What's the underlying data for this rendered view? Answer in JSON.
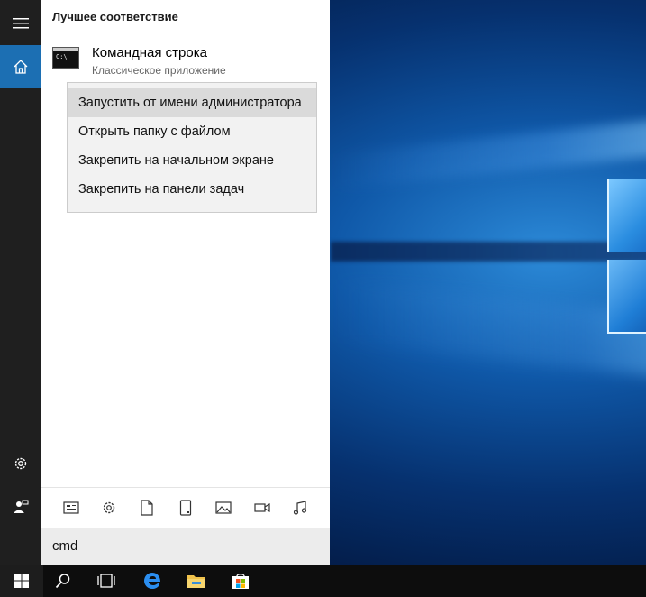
{
  "panel": {
    "section_title": "Лучшее соответствие",
    "best_match": {
      "title": "Командная строка",
      "subtitle": "Классическое приложение",
      "icon": "cmd-icon",
      "icon_text": "C:\\_"
    },
    "context_menu": {
      "items": [
        {
          "label": "Запустить от имени администратора",
          "highlighted": true
        },
        {
          "label": "Открыть папку с файлом",
          "highlighted": false
        },
        {
          "label": "Закрепить на начальном экране",
          "highlighted": false
        },
        {
          "label": "Закрепить на панели задач",
          "highlighted": false
        }
      ]
    },
    "filters": [
      "apps-filter-icon",
      "settings-filter-icon",
      "documents-filter-icon",
      "device-filter-icon",
      "photos-filter-icon",
      "videos-filter-icon",
      "music-filter-icon"
    ]
  },
  "search": {
    "query": "cmd"
  },
  "rail": [
    "hamburger-menu-icon",
    "home-icon",
    "settings-icon",
    "user-feedback-icon"
  ],
  "taskbar": [
    "start-icon",
    "search-icon",
    "task-view-icon",
    "edge-icon",
    "file-explorer-icon",
    "store-icon"
  ],
  "colors": {
    "accent": "#1c6fb3",
    "taskbar": "#0d0d0d",
    "rail": "#1f1f1f",
    "menu_highlight": "#dadada"
  }
}
